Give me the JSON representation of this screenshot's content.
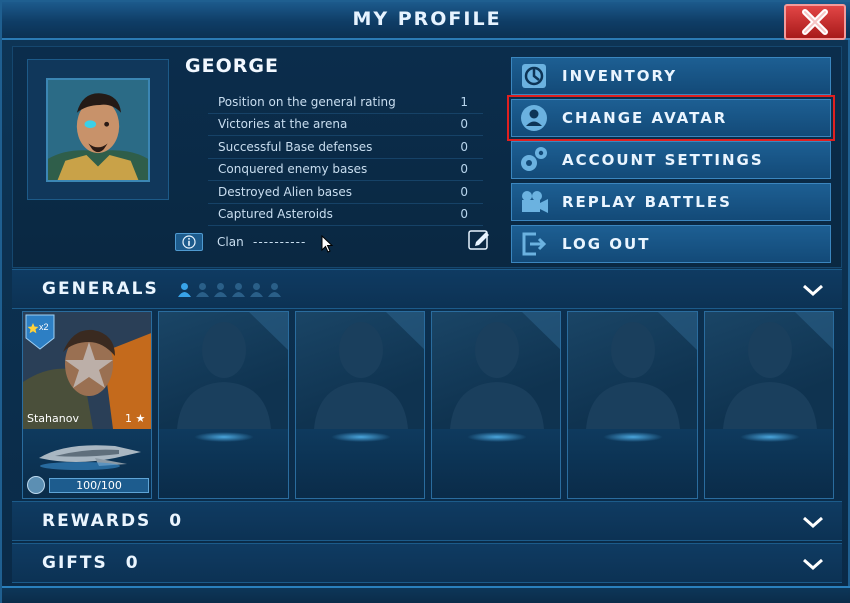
{
  "window": {
    "title": "MY PROFILE",
    "close_icon": "close-icon"
  },
  "player": {
    "name": "GEORGE",
    "stats": [
      {
        "label": "Position on the general rating",
        "value": "1"
      },
      {
        "label": "Victories at the arena",
        "value": "0"
      },
      {
        "label": "Successful Base defenses",
        "value": "0"
      },
      {
        "label": "Conquered enemy bases",
        "value": "0"
      },
      {
        "label": "Destroyed Alien bases",
        "value": "0"
      },
      {
        "label": "Captured Asteroids",
        "value": "0"
      }
    ],
    "clan_label": "Clan",
    "clan_value": "----------"
  },
  "menu": {
    "buttons": [
      {
        "label": "INVENTORY",
        "icon": "inventory-icon"
      },
      {
        "label": "CHANGE AVATAR",
        "icon": "avatar-icon",
        "highlighted": true
      },
      {
        "label": "ACCOUNT SETTINGS",
        "icon": "gears-icon"
      },
      {
        "label": "REPLAY BATTLES",
        "icon": "camera-icon"
      },
      {
        "label": "LOG OUT",
        "icon": "logout-icon"
      }
    ]
  },
  "generals": {
    "title": "GENERALS",
    "slots_total": 6,
    "slots_filled": 1,
    "active": {
      "rank": "x2",
      "name": "Stahanov",
      "level": "1",
      "hp": "100/100"
    },
    "empty_count": 5
  },
  "rewards": {
    "title": "REWARDS",
    "count": "0"
  },
  "gifts": {
    "title": "GIFTS",
    "count": "0"
  },
  "colors": {
    "accent": "#2a80bd",
    "panel": "#0b2d4c",
    "highlight": "#e02020",
    "close": "#c42a2a"
  }
}
